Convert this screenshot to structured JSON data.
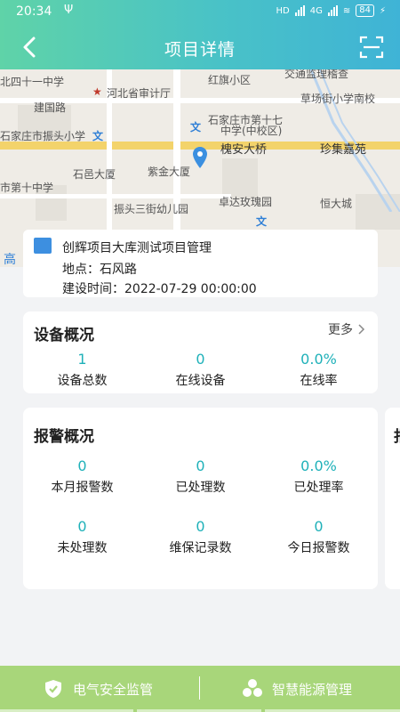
{
  "status_bar": {
    "time": "20:34",
    "usb": "Ψ",
    "network": "4G",
    "battery": "84"
  },
  "header": {
    "title": "项目详情",
    "back_icon": "chevron-left-icon",
    "scan_icon": "scan-icon"
  },
  "map": {
    "labels": {
      "l1": "北四十一中学",
      "l2": "河北省审计厅",
      "l3": "红旗小区",
      "l4": "交通监理稽查",
      "l5": "草场街小学南校",
      "l6": "建国路",
      "l7": "石家庄市振头小学",
      "l8": "石家庄市第十七",
      "l9": "中学(中校区)",
      "l10": "槐安大桥",
      "l11": "珍集嘉苑",
      "l12": "石邑大厦",
      "l13": "紫金大厦",
      "l14": "卓达玫瑰园",
      "l15": "恒大城",
      "l16": "振头三街幼儿园",
      "l17": "市第十中学",
      "l18": "高"
    }
  },
  "project": {
    "name": "创辉项目大库测试项目管理",
    "location_label": "地点：",
    "location": "石风路",
    "time_label": "建设时间：",
    "time": "2022-07-29 00:00:00"
  },
  "device_overview": {
    "title": "设备概况",
    "more": "更多",
    "stats": [
      {
        "value": "1",
        "label": "设备总数"
      },
      {
        "value": "0",
        "label": "在线设备"
      },
      {
        "value": "0.0%",
        "label": "在线率"
      }
    ]
  },
  "alarm_overview": {
    "title": "报警概况",
    "stats": [
      {
        "value": "0",
        "label": "本月报警数"
      },
      {
        "value": "0",
        "label": "已处理数"
      },
      {
        "value": "0.0%",
        "label": "已处理率"
      },
      {
        "value": "0",
        "label": "未处理数"
      },
      {
        "value": "0",
        "label": "维保记录数"
      },
      {
        "value": "0",
        "label": "今日报警数"
      }
    ]
  },
  "peek_card": {
    "title": "报"
  },
  "tabbar": {
    "items": [
      {
        "label": "电气安全监管",
        "icon": "shield-check-icon"
      },
      {
        "label": "智慧能源管理",
        "icon": "recycle-icon"
      }
    ]
  },
  "colors": {
    "accent": "#1fb1b9",
    "tabbar": "#a8d67a",
    "header_start": "#5fd3a8",
    "header_end": "#3fb3d6"
  }
}
